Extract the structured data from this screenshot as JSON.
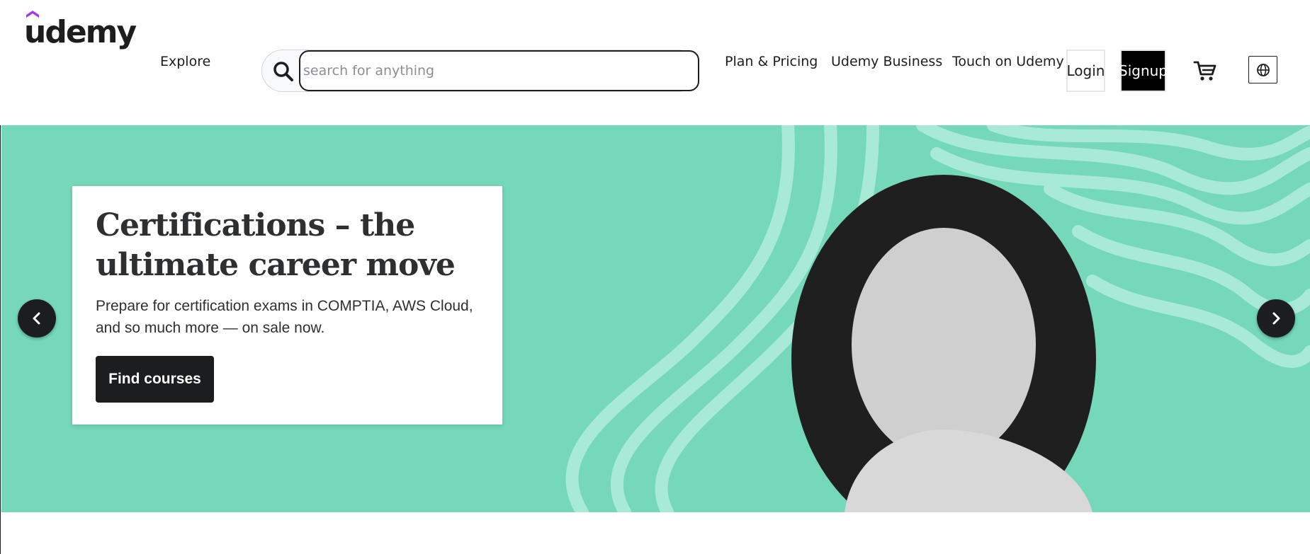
{
  "header": {
    "logo_text": "udemy",
    "explore_label": "Explore",
    "search": {
      "placeholder": "search for anything",
      "value": ""
    },
    "nav_links": {
      "plan_pricing": "Plan & Pricing",
      "business": "Udemy Business",
      "teach": "Touch on Udemy"
    },
    "login_label": "Login",
    "signup_label": "Signup",
    "icons": {
      "search": "search-icon",
      "cart": "cart-icon",
      "language": "globe-icon"
    }
  },
  "hero": {
    "title": "Certifications – the ultimate career move",
    "body": "Prepare for certification exams in COMPTIA, AWS Cloud, and so much more — on sale now.",
    "cta_label": "Find courses",
    "background_color": "#74d8b9",
    "icons": {
      "prev": "chevron-left-icon",
      "next": "chevron-right-icon"
    }
  },
  "colors": {
    "brand_purple": "#a435f0",
    "text_dark": "#1c1d1f",
    "hero_green": "#74d8b9",
    "hero_stripe": "#a8ead6"
  }
}
